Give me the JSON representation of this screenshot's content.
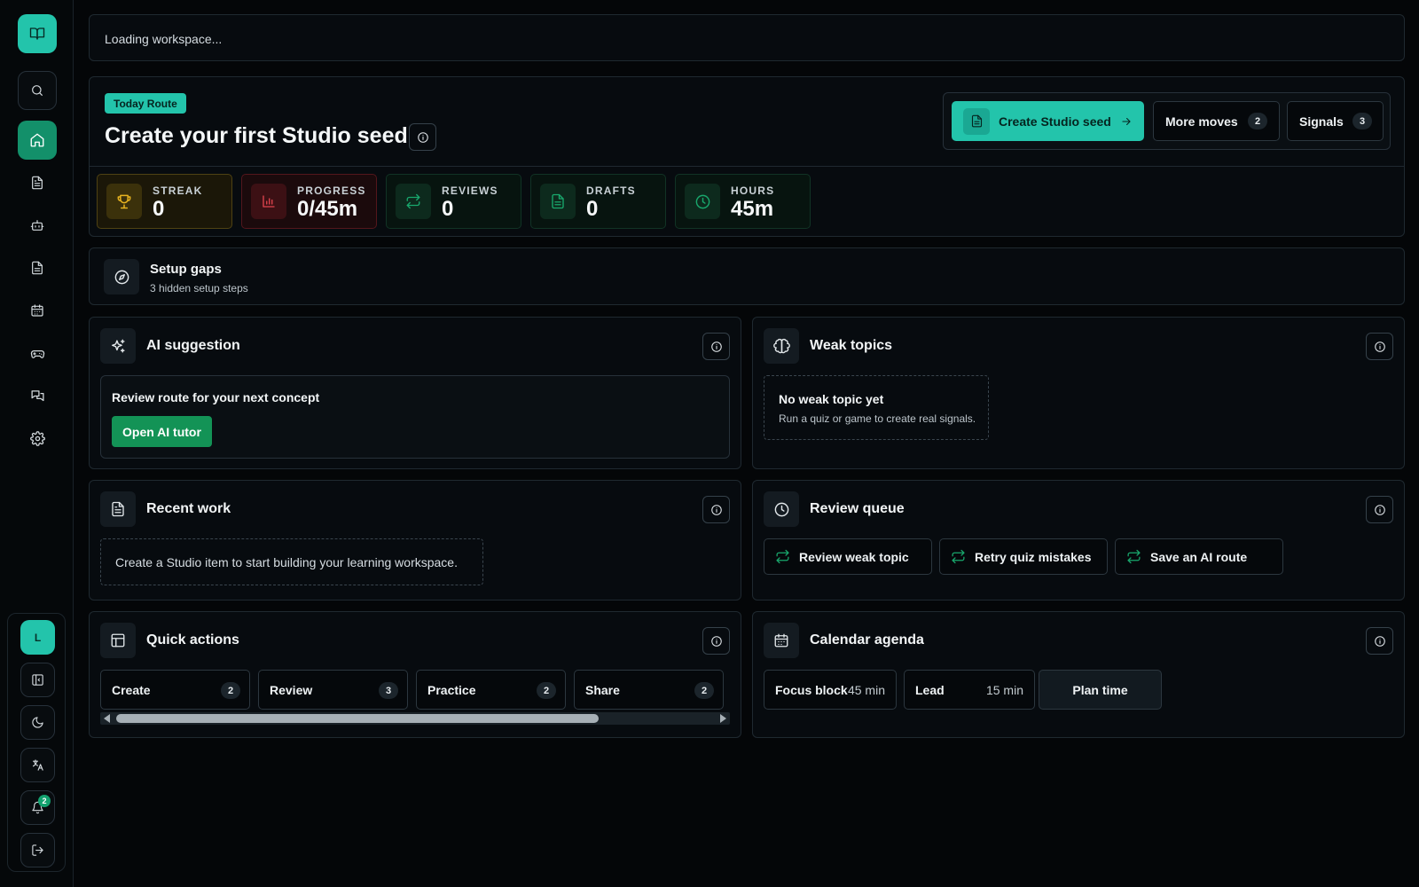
{
  "header": {
    "loading": "Loading workspace..."
  },
  "route": {
    "tag": "Today Route",
    "title": "Create your first Studio seed",
    "primary_label": "Create Studio seed",
    "more_moves": {
      "label": "More moves",
      "count": "2"
    },
    "signals": {
      "label": "Signals",
      "count": "3"
    }
  },
  "stats": [
    {
      "label": "STREAK",
      "value": "0",
      "icon": "trophy-icon",
      "tone": "gold"
    },
    {
      "label": "PROGRESS",
      "value": "0/45m",
      "icon": "bar-chart-icon",
      "tone": "red"
    },
    {
      "label": "REVIEWS",
      "value": "0",
      "icon": "repeat-icon",
      "tone": "green"
    },
    {
      "label": "DRAFTS",
      "value": "0",
      "icon": "file-icon",
      "tone": "green"
    },
    {
      "label": "HOURS",
      "value": "45m",
      "icon": "clock-icon",
      "tone": "green"
    }
  ],
  "setup": {
    "title": "Setup gaps",
    "subtitle": "3 hidden setup steps"
  },
  "ai": {
    "title": "AI suggestion",
    "text": "Review route for your next concept",
    "button": "Open AI tutor"
  },
  "weak": {
    "title": "Weak topics",
    "empty_title": "No weak topic yet",
    "empty_text": "Run a quiz or game to create real signals."
  },
  "recent": {
    "title": "Recent work",
    "empty_text": "Create a Studio item to start building your learning workspace."
  },
  "review_queue": {
    "title": "Review queue",
    "items": [
      "Review weak topic",
      "Retry quiz mistakes",
      "Save an AI route"
    ]
  },
  "quick": {
    "title": "Quick actions",
    "items": [
      {
        "label": "Create",
        "count": "2"
      },
      {
        "label": "Review",
        "count": "3"
      },
      {
        "label": "Practice",
        "count": "2"
      },
      {
        "label": "Share",
        "count": "2"
      }
    ]
  },
  "calendar": {
    "title": "Calendar agenda",
    "items": [
      {
        "label": "Focus block",
        "duration": "45 min"
      },
      {
        "label": "Lead",
        "duration": "15 min"
      }
    ],
    "plan_label": "Plan time"
  },
  "sidebar": {
    "avatar_initial": "L",
    "notifications_count": "2",
    "nav_icons": [
      "search-icon",
      "home-icon",
      "document-icon",
      "bot-icon",
      "notes-icon",
      "calendar-icon",
      "gamepad-icon",
      "chat-icon",
      "gear-icon"
    ]
  },
  "colors": {
    "accent": "#23c4ab",
    "success": "#139356",
    "background": "#040608"
  }
}
